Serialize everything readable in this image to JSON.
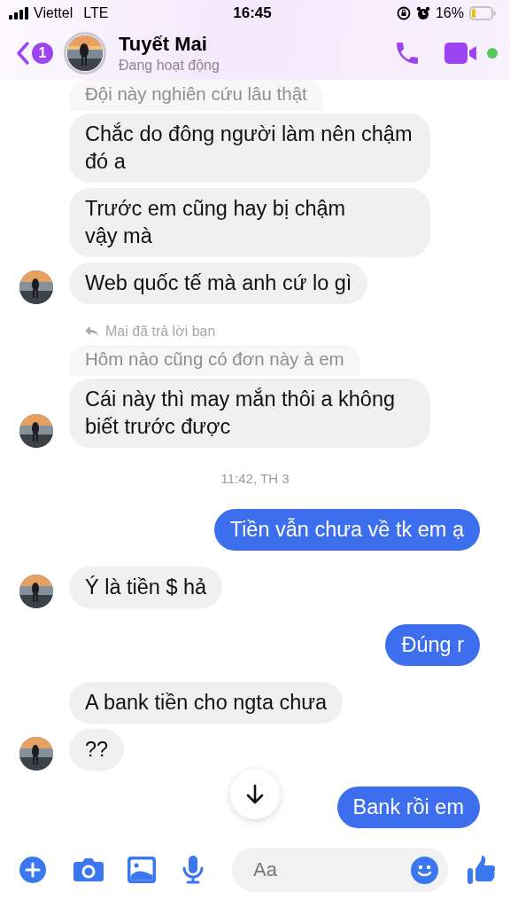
{
  "status_bar": {
    "carrier": "Viettel",
    "network": "LTE",
    "time": "16:45",
    "battery": "16%"
  },
  "header": {
    "back_count": "1",
    "name": "Tuyết Mai",
    "status": "Đang hoạt động",
    "online": true
  },
  "messages": [
    {
      "kind": "quoted",
      "text": "Đội này nghiên cứu lâu thật"
    },
    {
      "kind": "incoming",
      "text": "Chắc do đông người làm nên chậm đó a",
      "avatar": false
    },
    {
      "kind": "incoming",
      "text": "Trước em cũng hay bị chậm vậy mà",
      "avatar": false
    },
    {
      "kind": "incoming",
      "text": "Web quốc tế mà anh cứ lo gì",
      "avatar": true
    },
    {
      "kind": "reply_note",
      "text": "Mai đã trả lời bạn"
    },
    {
      "kind": "quoted",
      "text": "Hôm nào cũng có đơn này à em"
    },
    {
      "kind": "incoming",
      "text": "Cái này thì may mắn thôi a không biết trước được",
      "avatar": true
    },
    {
      "kind": "time",
      "text": "11:42, TH 3"
    },
    {
      "kind": "outgoing",
      "text": "Tiền vẫn chưa về tk em ạ"
    },
    {
      "kind": "incoming",
      "text": "Ý là tiền $ hả",
      "avatar": true
    },
    {
      "kind": "outgoing",
      "text": "Đúng r"
    },
    {
      "kind": "incoming",
      "text": "A bank tiền cho ngta chưa",
      "avatar": false
    },
    {
      "kind": "incoming",
      "text": "??",
      "avatar": true
    },
    {
      "kind": "outgoing",
      "text": "Bank rồi em"
    }
  ],
  "composer": {
    "placeholder": "Aa"
  }
}
